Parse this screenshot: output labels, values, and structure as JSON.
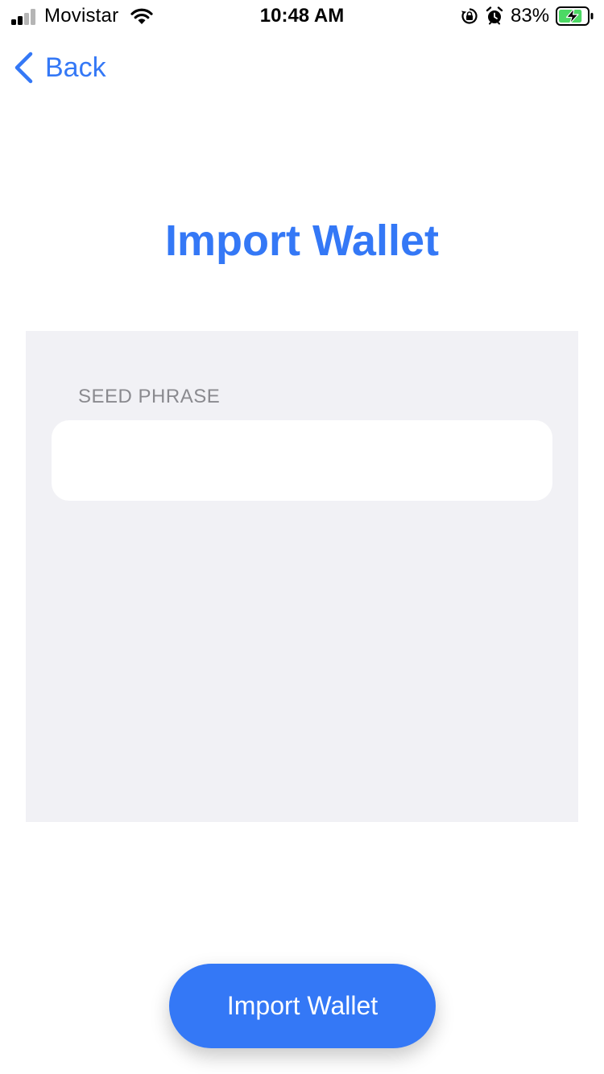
{
  "status_bar": {
    "carrier": "Movistar",
    "time": "10:48 AM",
    "battery_percent": "83%",
    "battery_level": 0.83,
    "signal_bars_active": 2,
    "signal_bars_total": 4,
    "icons": [
      "signal-icon",
      "wifi-icon",
      "rotation-lock-icon",
      "alarm-icon",
      "battery-charging-icon"
    ]
  },
  "nav": {
    "back_label": "Back",
    "back_icon": "chevron-left-icon"
  },
  "page": {
    "title": "Import Wallet"
  },
  "form": {
    "seed_label": "SEED PHRASE",
    "seed_value": "",
    "seed_placeholder": ""
  },
  "actions": {
    "import_label": "Import Wallet"
  },
  "colors": {
    "accent": "#3478f6",
    "panel_bg": "#f1f1f5",
    "label_gray": "#8a8a8f",
    "battery_green": "#4cd964"
  }
}
